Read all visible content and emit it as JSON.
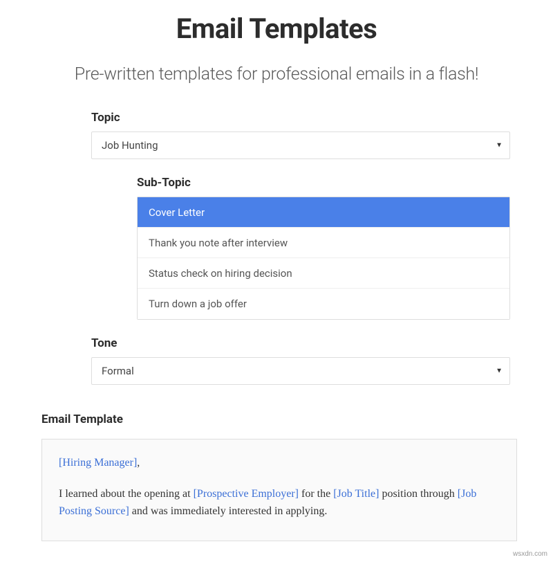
{
  "header": {
    "title": "Email Templates",
    "subtitle": "Pre-written templates for professional emails in a flash!"
  },
  "form": {
    "topic": {
      "label": "Topic",
      "selected": "Job Hunting"
    },
    "sub_topic": {
      "label": "Sub-Topic",
      "items": [
        {
          "label": "Cover Letter",
          "selected": true
        },
        {
          "label": "Thank you note after interview",
          "selected": false
        },
        {
          "label": "Status check on hiring decision",
          "selected": false
        },
        {
          "label": "Turn down a job offer",
          "selected": false
        }
      ]
    },
    "tone": {
      "label": "Tone",
      "selected": "Formal"
    }
  },
  "template": {
    "label": "Email Template",
    "greeting_placeholder": "[Hiring Manager]",
    "greeting_suffix": ",",
    "body_parts": {
      "p1_a": "I learned about the opening at ",
      "p1_ph1": "[Prospective Employer]",
      "p1_b": " for the ",
      "p1_ph2": "[Job Title]",
      "p1_c": " position through ",
      "p1_ph3": "[Job Posting Source]",
      "p1_d": " and was immediately interested in applying."
    }
  },
  "watermark": "wsxdn.com"
}
